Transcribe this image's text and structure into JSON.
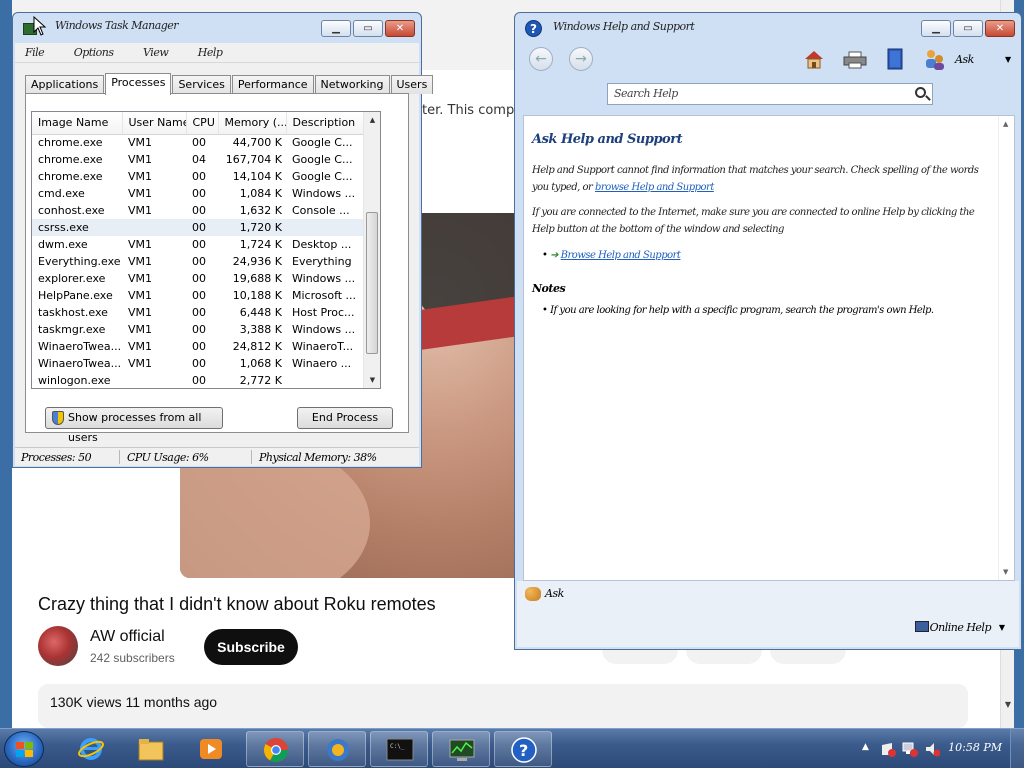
{
  "browser": {
    "info_text": "ter. This comput",
    "video": {
      "title": "Crazy thing that I didn't know about Roku remotes",
      "channel": "AW official",
      "subscribers": "242 subscribers",
      "subscribe_label": "Subscribe",
      "views": "130K views  11 months ago"
    }
  },
  "taskmgr": {
    "title": "Windows Task Manager",
    "menu": [
      "File",
      "Options",
      "View",
      "Help"
    ],
    "tabs": [
      "Applications",
      "Processes",
      "Services",
      "Performance",
      "Networking",
      "Users"
    ],
    "active_tab": "Processes",
    "columns": [
      "Image Name",
      "User Name",
      "CPU",
      "Memory (...",
      "Description"
    ],
    "rows": [
      {
        "name": "chrome.exe",
        "user": "VM1",
        "cpu": "00",
        "mem": "44,700 K",
        "desc": "Google C..."
      },
      {
        "name": "chrome.exe",
        "user": "VM1",
        "cpu": "04",
        "mem": "167,704 K",
        "desc": "Google C..."
      },
      {
        "name": "chrome.exe",
        "user": "VM1",
        "cpu": "00",
        "mem": "14,104 K",
        "desc": "Google C..."
      },
      {
        "name": "cmd.exe",
        "user": "VM1",
        "cpu": "00",
        "mem": "1,084 K",
        "desc": "Windows ..."
      },
      {
        "name": "conhost.exe",
        "user": "VM1",
        "cpu": "00",
        "mem": "1,632 K",
        "desc": "Console ..."
      },
      {
        "name": "csrss.exe",
        "user": "",
        "cpu": "00",
        "mem": "1,720 K",
        "desc": ""
      },
      {
        "name": "dwm.exe",
        "user": "VM1",
        "cpu": "00",
        "mem": "1,724 K",
        "desc": "Desktop ..."
      },
      {
        "name": "Everything.exe",
        "user": "VM1",
        "cpu": "00",
        "mem": "24,936 K",
        "desc": "Everything"
      },
      {
        "name": "explorer.exe",
        "user": "VM1",
        "cpu": "00",
        "mem": "19,688 K",
        "desc": "Windows ..."
      },
      {
        "name": "HelpPane.exe",
        "user": "VM1",
        "cpu": "00",
        "mem": "10,188 K",
        "desc": "Microsoft ..."
      },
      {
        "name": "taskhost.exe",
        "user": "VM1",
        "cpu": "00",
        "mem": "6,448 K",
        "desc": "Host Proc..."
      },
      {
        "name": "taskmgr.exe",
        "user": "VM1",
        "cpu": "00",
        "mem": "3,388 K",
        "desc": "Windows ..."
      },
      {
        "name": "WinaeroTwea...",
        "user": "VM1",
        "cpu": "00",
        "mem": "24,812 K",
        "desc": "WinaeroT..."
      },
      {
        "name": "WinaeroTwea...",
        "user": "VM1",
        "cpu": "00",
        "mem": "1,068 K",
        "desc": "Winaero ..."
      },
      {
        "name": "winlogon.exe",
        "user": "",
        "cpu": "00",
        "mem": "2,772 K",
        "desc": ""
      }
    ],
    "selected_row": 5,
    "show_all_label": "Show processes from all users",
    "end_process_label": "End Process",
    "status": {
      "processes": "Processes: 50",
      "cpu": "CPU Usage: 6%",
      "memory": "Physical Memory: 38%"
    }
  },
  "help": {
    "title": "Windows Help and Support",
    "toolbar_label": "Ask",
    "search_placeholder": "Search Help",
    "heading": "Ask Help and Support",
    "para1": "Help and Support cannot find information that matches your search. Check spelling of the words you typed, or",
    "para1_link": "browse Help and Support",
    "para2": "If you are connected to the Internet, make sure you are connected to online Help by clicking the Help button at the bottom of the window and selecting",
    "bullet1": "Browse Help and Support",
    "subhead": "Notes",
    "bullet2": "If you are looking for help with a specific program, search the program's own Help."
  },
  "help_bottom": {
    "ask_label": "Ask",
    "online_label": "Online Help"
  },
  "taskbar": {
    "apps": [
      "internet-explorer",
      "file-explorer",
      "media-player",
      "chrome",
      "winaero",
      "cmd",
      "task-manager",
      "help"
    ],
    "clock": "10:58 PM"
  }
}
